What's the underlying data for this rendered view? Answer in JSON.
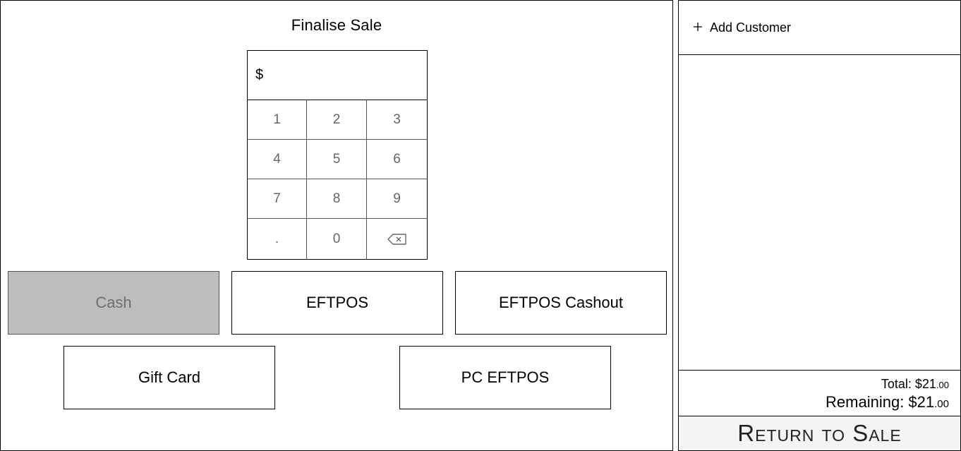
{
  "page_title": "Finalise Sale",
  "amount": {
    "currency_symbol": "$",
    "value": ""
  },
  "keypad": {
    "keys": [
      "1",
      "2",
      "3",
      "4",
      "5",
      "6",
      "7",
      "8",
      "9",
      ".",
      "0"
    ],
    "backspace_icon": "backspace-icon"
  },
  "payment_methods": {
    "cash": "Cash",
    "eftpos": "EFTPOS",
    "eftpos_cashout": "EFTPOS Cashout",
    "gift_card": "Gift Card",
    "pc_eftpos": "PC EFTPOS"
  },
  "sidebar": {
    "add_customer_icon": "plus-icon",
    "add_customer_label": "Add Customer",
    "total_label": "Total: ",
    "total_dollars": "$21",
    "total_cents": ".00",
    "remaining_label": "Remaining: ",
    "remaining_dollars": "$21",
    "remaining_cents": ".00",
    "return_label": "Return to Sale"
  },
  "colors": {
    "disabled_button_bg": "#bdbdbd",
    "disabled_button_text": "#6f6f6f",
    "key_text": "#666666",
    "return_button_bg": "#f4f4f4"
  }
}
